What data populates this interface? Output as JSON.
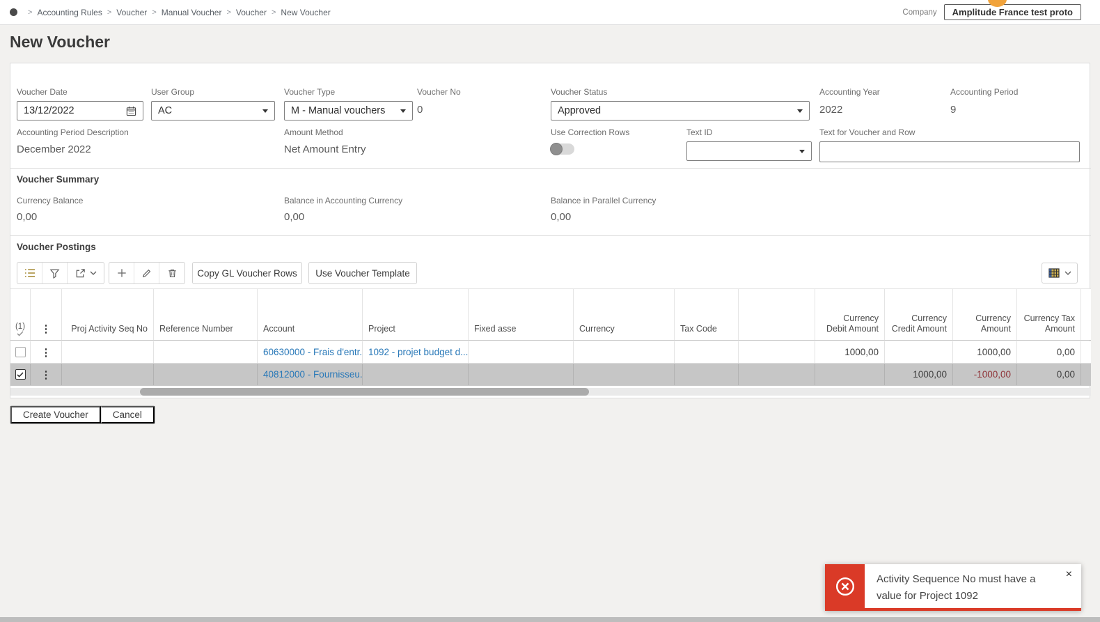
{
  "topbar": {
    "breadcrumb": [
      "Accounting Rules",
      "Voucher",
      "Manual Voucher",
      "Voucher",
      "New Voucher"
    ],
    "separator": ">",
    "company_label": "Company",
    "company_value": "Amplitude France test proto"
  },
  "page": {
    "title": "New Voucher"
  },
  "form": {
    "voucher_date": {
      "label": "Voucher Date",
      "value": "13/12/2022"
    },
    "user_group": {
      "label": "User Group",
      "value": "AC"
    },
    "voucher_type": {
      "label": "Voucher Type",
      "value": "M - Manual vouchers"
    },
    "voucher_no": {
      "label": "Voucher No",
      "value": "0"
    },
    "voucher_status": {
      "label": "Voucher Status",
      "value": "Approved"
    },
    "accounting_year": {
      "label": "Accounting Year",
      "value": "2022"
    },
    "accounting_period": {
      "label": "Accounting Period",
      "value": "9"
    },
    "accounting_period_description": {
      "label": "Accounting Period Description",
      "value": "December 2022"
    },
    "amount_method": {
      "label": "Amount Method",
      "value": "Net Amount Entry"
    },
    "use_correction_rows": {
      "label": "Use Correction Rows",
      "state": "off"
    },
    "text_id": {
      "label": "Text ID",
      "value": ""
    },
    "text_for_voucher_and_row": {
      "label": "Text for Voucher and Row",
      "value": ""
    }
  },
  "summary": {
    "title": "Voucher Summary",
    "fields": [
      {
        "label": "Currency Balance",
        "value": "0,00"
      },
      {
        "label": "Balance in Accounting Currency",
        "value": "0,00"
      },
      {
        "label": "Balance in Parallel Currency",
        "value": "0,00"
      }
    ]
  },
  "postings": {
    "title": "Voucher Postings",
    "toolbar": {
      "copy_gl_label": "Copy GL Voucher Rows",
      "use_template_label": "Use Voucher Template"
    },
    "table": {
      "selection_count": "(1)",
      "columns": [
        "Proj Activity Seq No",
        "Reference Number",
        "Account",
        "Project",
        "Fixed asse",
        "Currency",
        "Tax Code",
        "Currency Debit Amount",
        "Currency Credit Amount",
        "Currency Amount",
        "Currency Tax Amount"
      ],
      "rows": [
        {
          "selected": false,
          "account": "60630000 - Frais d'entr...",
          "project": "1092 - projet budget d...",
          "currency_debit_amount": "1000,00",
          "currency_credit_amount": "",
          "currency_amount": "1000,00",
          "currency_tax_amount": "0,00"
        },
        {
          "selected": true,
          "account": "40812000 - Fournisseu...",
          "project": "",
          "currency_debit_amount": "",
          "currency_credit_amount": "1000,00",
          "currency_amount": "-1000,00",
          "currency_tax_amount": "0,00"
        }
      ]
    }
  },
  "footer": {
    "create_label": "Create Voucher",
    "cancel_label": "Cancel"
  },
  "toast": {
    "message": "Activity Sequence No must have a value for Project 1092"
  },
  "icons": {
    "kebab": "⋮",
    "close": "×"
  },
  "colors": {
    "toolbar_accent": "#a98f3d",
    "link": "#2878b8",
    "negative": "#8f3237",
    "toast_red": "#da3a27",
    "selected_row": "#c6c6c6"
  }
}
